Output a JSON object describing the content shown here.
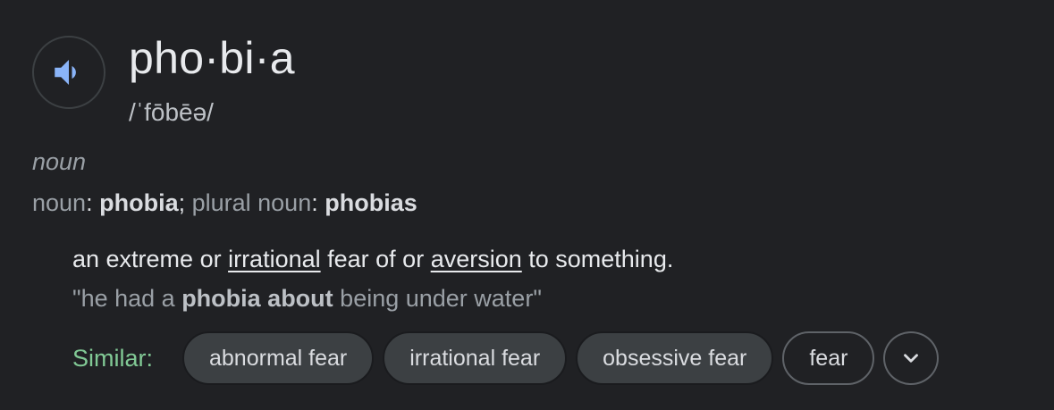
{
  "entry": {
    "word": "pho·bi·a",
    "pronunciation": "/ˈfōbēə/",
    "part_of_speech": "noun",
    "forms": {
      "label1": "noun",
      "value1": "phobia",
      "label2": "plural noun",
      "value2": "phobias"
    },
    "definition": {
      "part1": "an extreme or ",
      "link1": "irrational",
      "part2": " fear of or ",
      "link2": "aversion",
      "part3": " to something."
    },
    "example": {
      "before": "\"he had a ",
      "bold": "phobia about",
      "after": " being under water\""
    }
  },
  "similar": {
    "label": "Similar:",
    "chips": [
      "abnormal fear",
      "irrational fear",
      "obsessive fear",
      "fear"
    ]
  },
  "icons": {
    "speaker": "volume-icon",
    "expand": "chevron-down-icon"
  },
  "colors": {
    "background": "#202124",
    "speaker_blue": "#8ab4f8",
    "similar_green": "#81c995"
  }
}
